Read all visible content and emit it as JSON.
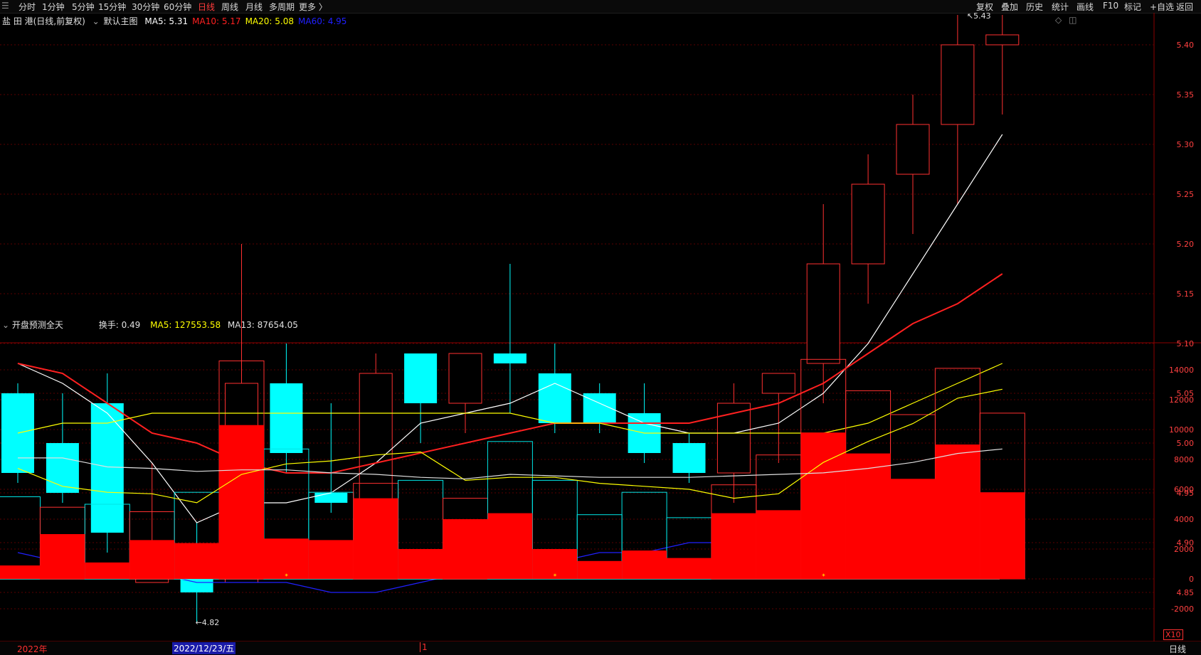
{
  "toolbar": {
    "periods": [
      "分时",
      "1分钟",
      "5分钟",
      "15分钟",
      "30分钟",
      "60分钟",
      "日线",
      "周线",
      "月线",
      "多周期",
      "更多 〉"
    ],
    "active_period": "日线",
    "right_items": [
      "复权",
      "叠加",
      "历史",
      "统计",
      "画线",
      "F10",
      "标记",
      "+自选",
      "返回"
    ]
  },
  "header": {
    "stock_name": "盐 田 港(日线,前复权)",
    "main_indicator": "默认主图",
    "ma_labels": [
      {
        "text": "MA5: 5.31",
        "color": "#ffffff"
      },
      {
        "text": "MA10: 5.17",
        "color": "#ff2020"
      },
      {
        "text": "MA20: 5.08",
        "color": "#ffff00"
      },
      {
        "text": "MA60: 4.95",
        "color": "#2020ff"
      }
    ]
  },
  "volume_header": {
    "indicator": "开盘预测全天",
    "turnover": "换手: 0.49",
    "ma5": "MA5: 127553.58",
    "ma13": "MA13: 87654.05",
    "unit": "X10"
  },
  "footer": {
    "year_label": "2022年",
    "cursor_date": "2022/12/23/五",
    "marker": "1",
    "period_label": "日线"
  },
  "chart_data": [
    {
      "type": "candlestick",
      "title": "盐 田 港(日线,前复权)",
      "ylim": [
        4.8,
        5.45
      ],
      "y_ticks": [
        4.85,
        4.9,
        4.95,
        5.0,
        5.05,
        5.1,
        5.15,
        5.2,
        5.25,
        5.3,
        5.35,
        5.4
      ],
      "annotations": [
        {
          "label": "5.43",
          "value": 5.43
        },
        {
          "label": "4.82",
          "value": 4.82
        }
      ],
      "candles": [
        {
          "open": 5.05,
          "high": 5.06,
          "low": 4.96,
          "close": 4.97
        },
        {
          "open": 5.0,
          "high": 5.05,
          "low": 4.94,
          "close": 4.95
        },
        {
          "open": 5.04,
          "high": 5.07,
          "low": 4.89,
          "close": 4.91
        },
        {
          "open": 4.86,
          "high": 4.98,
          "low": 4.86,
          "close": 4.89
        },
        {
          "open": 4.88,
          "high": 4.92,
          "low": 4.82,
          "close": 4.85
        },
        {
          "open": 4.86,
          "high": 5.2,
          "low": 4.86,
          "close": 5.06
        },
        {
          "open": 5.06,
          "high": 5.1,
          "low": 4.97,
          "close": 4.99
        },
        {
          "open": 4.95,
          "high": 5.04,
          "low": 4.93,
          "close": 4.94
        },
        {
          "open": 4.94,
          "high": 5.09,
          "low": 4.93,
          "close": 5.07
        },
        {
          "open": 5.09,
          "high": 5.09,
          "low": 5.0,
          "close": 5.04
        },
        {
          "open": 5.04,
          "high": 5.09,
          "low": 5.01,
          "close": 5.09
        },
        {
          "open": 5.09,
          "high": 5.18,
          "low": 5.03,
          "close": 5.08
        },
        {
          "open": 5.07,
          "high": 5.1,
          "low": 5.01,
          "close": 5.02
        },
        {
          "open": 5.05,
          "high": 5.06,
          "low": 5.01,
          "close": 5.02
        },
        {
          "open": 5.03,
          "high": 5.06,
          "low": 4.98,
          "close": 4.99
        },
        {
          "open": 5.0,
          "high": 5.01,
          "low": 4.96,
          "close": 4.97
        },
        {
          "open": 4.97,
          "high": 5.06,
          "low": 4.94,
          "close": 5.04
        },
        {
          "open": 5.05,
          "high": 5.07,
          "low": 4.98,
          "close": 5.07
        },
        {
          "open": 5.08,
          "high": 5.24,
          "low": 5.04,
          "close": 5.18
        },
        {
          "open": 5.18,
          "high": 5.29,
          "low": 5.14,
          "close": 5.26
        },
        {
          "open": 5.27,
          "high": 5.35,
          "low": 5.21,
          "close": 5.32
        },
        {
          "open": 5.32,
          "high": 5.43,
          "low": 5.24,
          "close": 5.4
        },
        {
          "open": 5.4,
          "high": 5.43,
          "low": 5.33,
          "close": 5.41
        }
      ],
      "series": [
        {
          "name": "MA5",
          "color": "#ffffff",
          "values": [
            5.08,
            5.06,
            5.03,
            4.98,
            4.92,
            4.94,
            4.94,
            4.95,
            4.98,
            5.02,
            5.03,
            5.04,
            5.06,
            5.04,
            5.02,
            5.01,
            5.01,
            5.02,
            5.05,
            5.1,
            5.17,
            5.24,
            5.31
          ]
        },
        {
          "name": "MA10",
          "color": "#ff2020",
          "values": [
            5.08,
            5.07,
            5.04,
            5.01,
            5.0,
            4.98,
            4.97,
            4.97,
            4.98,
            4.99,
            5.0,
            5.01,
            5.02,
            5.02,
            5.02,
            5.02,
            5.03,
            5.04,
            5.06,
            5.09,
            5.12,
            5.14,
            5.17
          ]
        },
        {
          "name": "MA20",
          "color": "#ffff00",
          "values": [
            5.01,
            5.02,
            5.02,
            5.03,
            5.03,
            5.03,
            5.03,
            5.03,
            5.03,
            5.03,
            5.03,
            5.03,
            5.02,
            5.02,
            5.01,
            5.01,
            5.01,
            5.01,
            5.01,
            5.02,
            5.04,
            5.06,
            5.08
          ]
        },
        {
          "name": "MA60",
          "color": "#2020ff",
          "values": [
            4.89,
            4.88,
            4.87,
            4.87,
            4.86,
            4.86,
            4.86,
            4.85,
            4.85,
            4.86,
            4.87,
            4.88,
            4.88,
            4.89,
            4.89,
            4.9,
            4.9,
            4.91,
            4.92,
            4.93,
            4.94,
            4.95,
            4.95
          ]
        }
      ]
    },
    {
      "type": "bar",
      "title": "开盘预测全天",
      "ylim": [
        -3000,
        15000
      ],
      "y_ticks": [
        -2000,
        0,
        2000,
        4000,
        6000,
        8000,
        10000,
        12000,
        14000
      ],
      "full_day": [
        5500,
        4800,
        5000,
        4500,
        5800,
        14600,
        8700,
        5800,
        6400,
        6600,
        5400,
        9200,
        6600,
        4300,
        5800,
        4100,
        6300,
        8300,
        14700,
        12600,
        11000,
        14100,
        11100
      ],
      "open_bars": [
        900,
        3000,
        1100,
        2600,
        2400,
        10300,
        2700,
        2600,
        5400,
        2000,
        4000,
        4400,
        2000,
        1200,
        1900,
        1400,
        4400,
        4600,
        9800,
        8400,
        6700,
        9000,
        5800
      ],
      "color_up": [
        false,
        true,
        false,
        true,
        false,
        true,
        false,
        false,
        true,
        false,
        true,
        false,
        false,
        false,
        false,
        false,
        true,
        true,
        true,
        true,
        true,
        true,
        true
      ],
      "series": [
        {
          "name": "MA5",
          "color": "#ffff00",
          "values": [
            7400,
            6200,
            5800,
            5700,
            5100,
            7000,
            7700,
            7900,
            8300,
            8500,
            6600,
            6800,
            6800,
            6400,
            6200,
            6000,
            5400,
            5700,
            7800,
            9200,
            10400,
            12100,
            12700
          ]
        },
        {
          "name": "MA13",
          "color": "#e0e0e0",
          "values": [
            8100,
            8100,
            7500,
            7400,
            7200,
            7300,
            7300,
            7100,
            7000,
            6800,
            6700,
            7000,
            6900,
            6800,
            6800,
            6800,
            6900,
            7000,
            7100,
            7400,
            7800,
            8400,
            8700
          ]
        }
      ]
    }
  ]
}
